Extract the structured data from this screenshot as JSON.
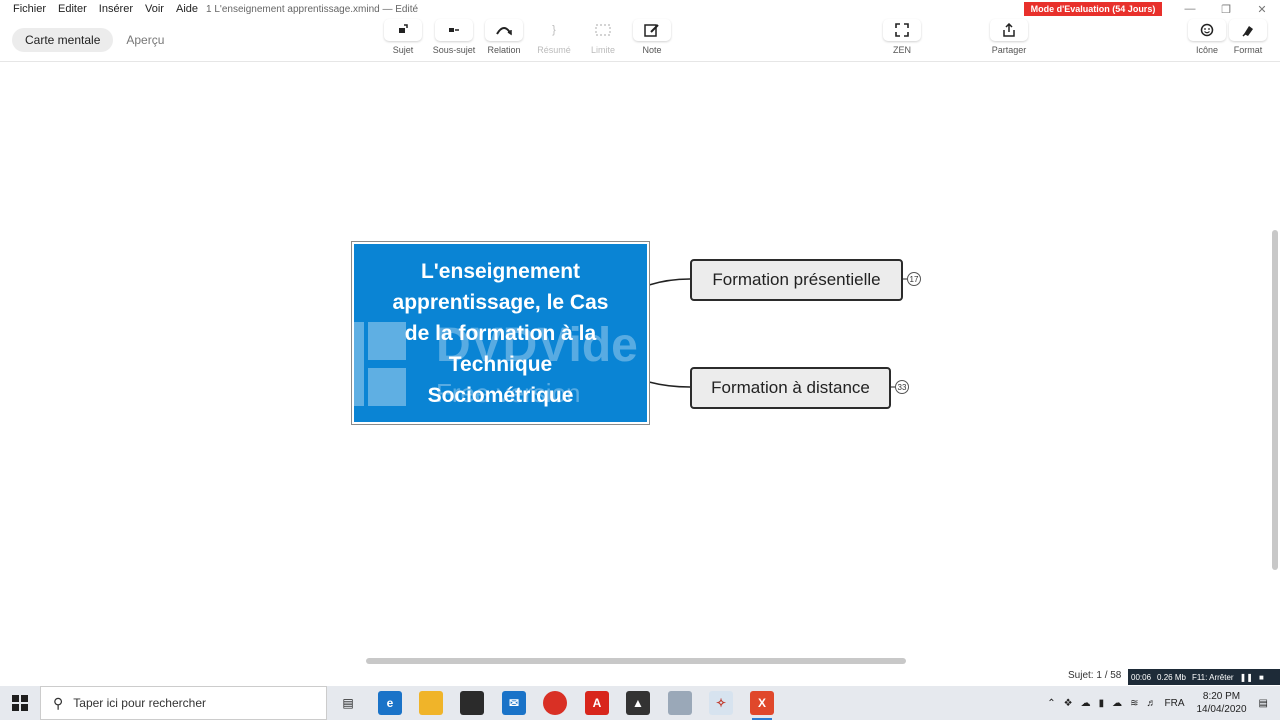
{
  "menubar": {
    "items": [
      "Fichier",
      "Editer",
      "Insérer",
      "Voir",
      "Aide"
    ],
    "document_title": "1 L'enseignement apprentissage.xmind — Edité",
    "evaluation_badge": "Mode d'Evaluation (54 Jours)"
  },
  "toolbar": {
    "views": [
      "Carte mentale",
      "Aperçu"
    ],
    "tools": {
      "sujet": "Sujet",
      "sous_sujet": "Sous-sujet",
      "relation": "Relation",
      "resume": "Résumé",
      "limite": "Limite",
      "note": "Note",
      "zen": "ZEN",
      "partager": "Partager",
      "icone": "Icône",
      "format": "Format"
    }
  },
  "map": {
    "central_topic": {
      "lines": [
        "L'enseignement",
        "apprentissage, le Cas",
        "de la formation à la",
        "Technique",
        "Sociométrique"
      ],
      "fill_color": "#0a84d4"
    },
    "subtopics": [
      {
        "label": "Formation présentielle",
        "count": "17"
      },
      {
        "label": "Formation à distance",
        "count": "33"
      }
    ],
    "watermark": {
      "brand": "DVDVide",
      "sub": "Free version"
    }
  },
  "status": {
    "topic_count": "Sujet: 1 / 58",
    "recorder": [
      "00:06",
      "0.26 Mb",
      "F11: Arrêter"
    ]
  },
  "taskbar": {
    "search_placeholder": "Taper ici pour rechercher",
    "language": "FRA",
    "time": "8:20 PM",
    "date": "14/04/2020"
  }
}
